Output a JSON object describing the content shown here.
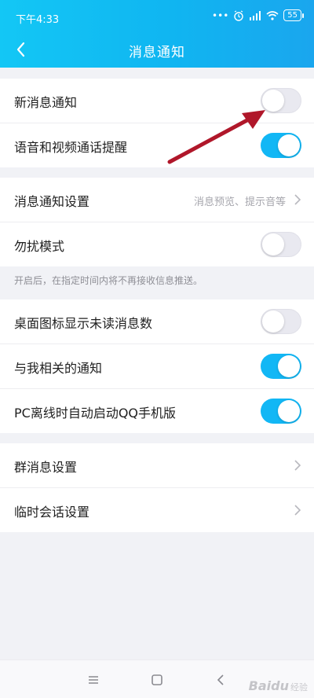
{
  "status_bar": {
    "time": "下午4:33",
    "battery": "55"
  },
  "header": {
    "title": "消息通知"
  },
  "colors": {
    "accent": "#12b7f5",
    "toggle_off": "#e9e9f0",
    "arrow": "#b0172a"
  },
  "section1": {
    "items": [
      {
        "label": "新消息通知",
        "toggle": false
      },
      {
        "label": "语音和视频通话提醒",
        "toggle": true
      }
    ]
  },
  "section2": {
    "items": [
      {
        "label": "消息通知设置",
        "value": "消息预览、提示音等"
      },
      {
        "label": "勿扰模式",
        "toggle": false
      }
    ],
    "hint": "开启后，在指定时间内将不再接收信息推送。"
  },
  "section3": {
    "items": [
      {
        "label": "桌面图标显示未读消息数",
        "toggle": false
      },
      {
        "label": "与我相关的通知",
        "toggle": true
      },
      {
        "label": "PC离线时自动启动QQ手机版",
        "toggle": true
      }
    ]
  },
  "section4": {
    "items": [
      {
        "label": "群消息设置"
      },
      {
        "label": "临时会话设置"
      }
    ]
  },
  "watermark": {
    "brand": "Baidu",
    "sub": "经验"
  }
}
